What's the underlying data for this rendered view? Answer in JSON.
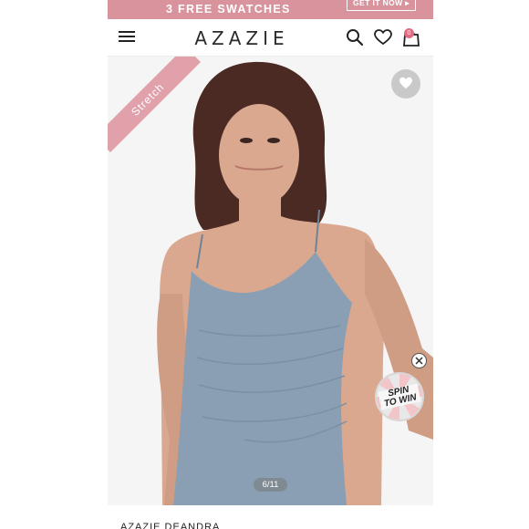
{
  "promo": {
    "text": "3 FREE SWATCHES",
    "button_label": "GET IT NOW ▸"
  },
  "header": {
    "logo": "AZAZIE",
    "cart_count": "0",
    "icons": [
      "menu-icon",
      "search-icon",
      "heart-icon",
      "bag-icon"
    ]
  },
  "product": {
    "badge": "Stretch",
    "image_counter": "6/11",
    "name": "AZAZIE DEANDRA"
  },
  "widgets": {
    "spin_line1": "SPIN",
    "spin_line2": "TO WIN"
  },
  "colors": {
    "banner": "#d9939d",
    "ribbon": "#e0a1ab",
    "dress": "#8a9fb3",
    "badge": "#e26d80"
  }
}
